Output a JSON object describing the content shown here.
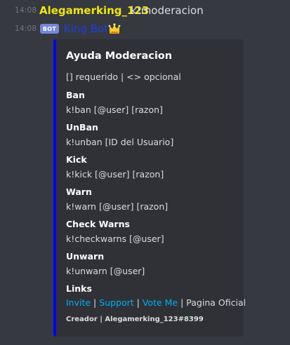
{
  "messages": [
    {
      "timestamp": "14:08",
      "author": "Alegamerking_123",
      "author_color": "#f1e60c",
      "content": "k!moderacion"
    },
    {
      "timestamp": "14:08",
      "bot_tag": "BOT",
      "author": "King Bot",
      "author_color": "#1f3de0",
      "author_icon": "crown-icon"
    }
  ],
  "embed": {
    "accent_color": "#0000ff",
    "title": "Ayuda Moderacion",
    "legend": "[] requerido | <> opcional",
    "fields": [
      {
        "name": "Ban",
        "value": "k!ban [@user] [razon]"
      },
      {
        "name": "UnBan",
        "value": "k!unban [ID del Usuario]"
      },
      {
        "name": "Kick",
        "value": "k!kick [@user] [razon]"
      },
      {
        "name": "Warn",
        "value": "k!warn [@user] [razon]"
      },
      {
        "name": "Check Warns",
        "value": "k!checkwarns [@user]"
      },
      {
        "name": "Unwarn",
        "value": "k!unwarn [@user]"
      }
    ],
    "links": {
      "name": "Links",
      "items": [
        "Invite",
        "Support",
        "Vote Me"
      ],
      "separator": " | ",
      "trailing_text": "Pagina Oficial"
    },
    "footer": "Creador | Alegamerking_123#8399"
  }
}
